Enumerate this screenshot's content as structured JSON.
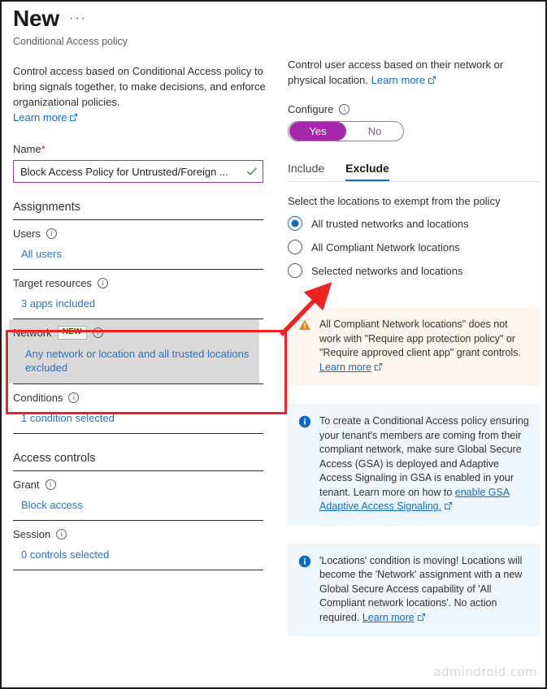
{
  "header": {
    "title": "New",
    "ellipsis": "···",
    "subtitle": "Conditional Access policy"
  },
  "left": {
    "description": "Control access based on Conditional Access policy to bring signals together, to make decisions, and enforce organizational policies.",
    "description_link": "Learn more",
    "name_label": "Name",
    "name_required": "*",
    "name_value": "Block Access Policy for Untrusted/Foreign ...",
    "assignments_title": "Assignments",
    "groups": [
      {
        "label": "Users",
        "value": "All users"
      },
      {
        "label": "Target resources",
        "value": "3 apps included"
      },
      {
        "label": "Network",
        "badge": "NEW",
        "value": "Any network or location and all trusted locations excluded"
      },
      {
        "label": "Conditions",
        "value": "1 condition selected"
      }
    ],
    "access_controls_title": "Access controls",
    "control_groups": [
      {
        "label": "Grant",
        "value": "Block access"
      },
      {
        "label": "Session",
        "value": "0 controls selected"
      }
    ]
  },
  "right": {
    "description": "Control user access based on their network or physical location.",
    "description_link": "Learn more",
    "configure_label": "Configure",
    "toggle": {
      "yes": "Yes",
      "no": "No",
      "selected": "Yes"
    },
    "tabs": [
      {
        "label": "Include",
        "active": false
      },
      {
        "label": "Exclude",
        "active": true
      }
    ],
    "radio_intro": "Select the locations to exempt from the policy",
    "radios": [
      {
        "label": "All trusted networks and locations",
        "selected": true
      },
      {
        "label": "All Compliant Network locations",
        "selected": false
      },
      {
        "label": "Selected networks and locations",
        "selected": false
      }
    ],
    "messages": [
      {
        "kind": "warning",
        "text": "All Compliant Network locations\" does not work with \"Require app protection policy\" or \"Require approved client app\" grant controls. ",
        "link": "Learn more"
      },
      {
        "kind": "info",
        "text": "To create a Conditional Access policy ensuring your tenant's members are coming from their compliant network, make sure Global Secure Access (GSA) is deployed and Adaptive Access Signaling in GSA is enabled in your tenant. Learn more on how to ",
        "link": "enable GSA Adaptive Access Signaling."
      },
      {
        "kind": "info",
        "text": "'Locations' condition is moving! Locations will become the 'Network' assignment with a new Global Secure Access capability of 'All Compliant network locations'. No action required. ",
        "link": "Learn more"
      }
    ]
  },
  "annotations": {
    "highlight_color": "#ee2222",
    "arrow_color": "#ee2222"
  },
  "watermark": "admindroid.com"
}
